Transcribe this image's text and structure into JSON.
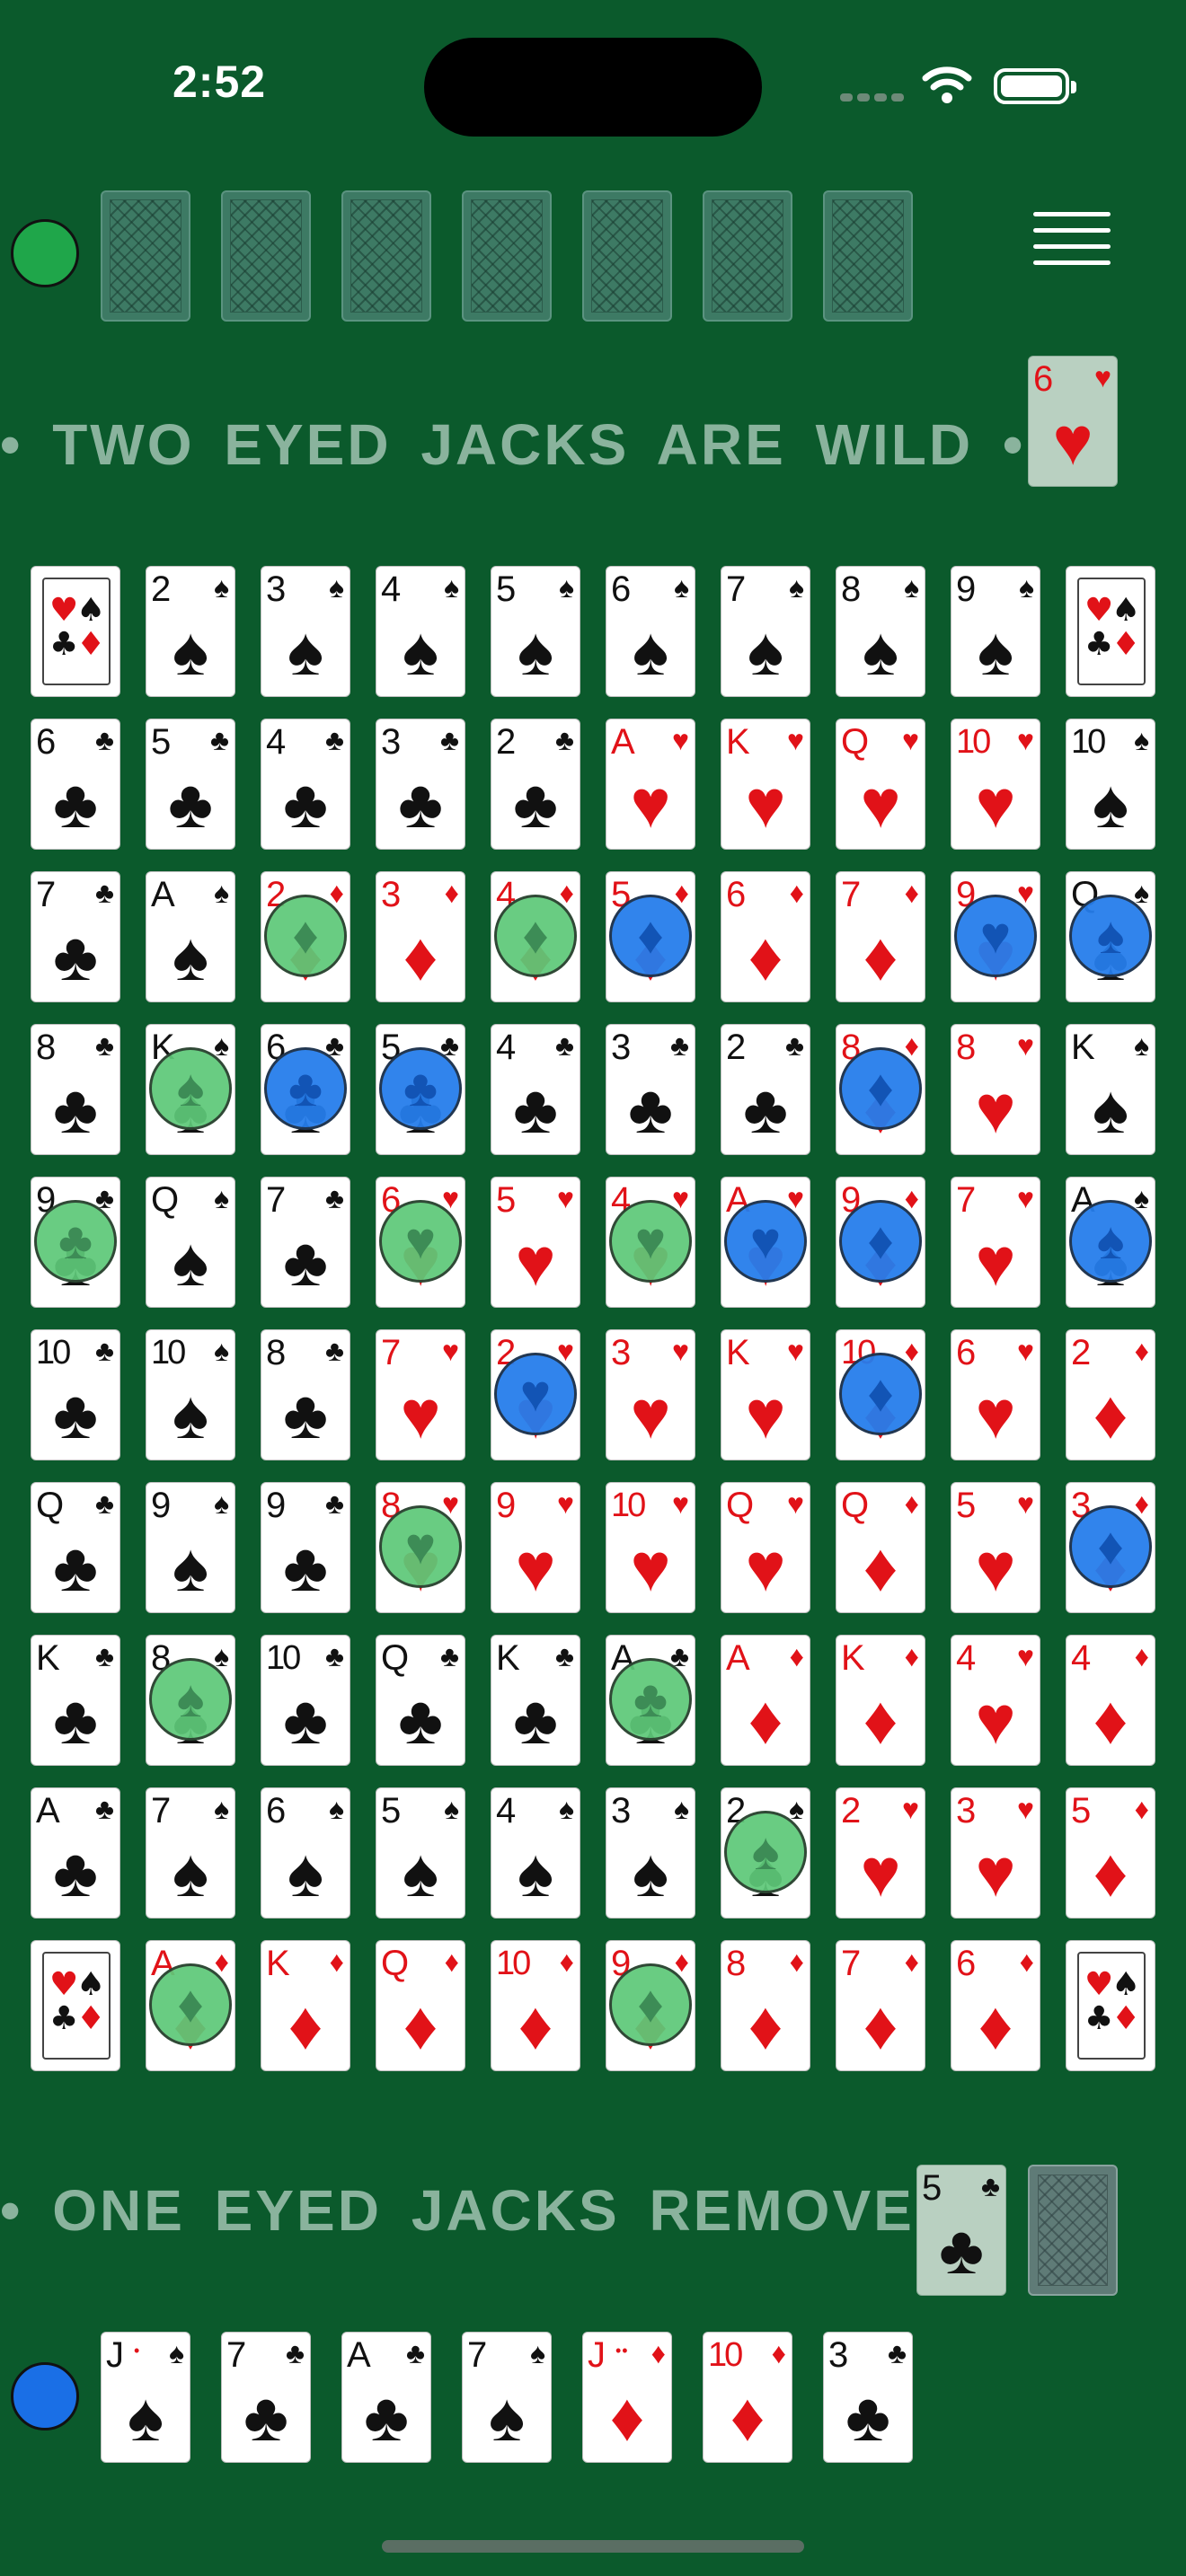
{
  "status_bar": {
    "time": "2:52"
  },
  "colors": {
    "felt": "#0b5a2c",
    "red_suit": "#e11218",
    "black_suit": "#111111",
    "opponent_color": "#1fa64a",
    "player_color": "#1a6fe6",
    "green_chip": "#5ec878",
    "blue_chip": "#2679eb"
  },
  "icons": {
    "menu": "hamburger-menu-icon",
    "wifi": "wifi-icon",
    "battery": "battery-icon",
    "card_back": "card-back-icon",
    "free_corner": "free-corner-suits-icon"
  },
  "top_banner": "• TWO EYED JACKS ARE WILD •",
  "bottom_banner": "• ONE EYED JACKS REMOVE •",
  "opponent": {
    "color": "green",
    "card_count": 7
  },
  "top_discard": {
    "rank": "6",
    "suit": "♥",
    "color": "red"
  },
  "bottom_discard": {
    "rank": "5",
    "suit": "♣",
    "color": "black"
  },
  "player": {
    "color": "blue",
    "hand": [
      {
        "rank": "J",
        "suit": "♠",
        "color": "black",
        "jack_eyes": "•"
      },
      {
        "rank": "7",
        "suit": "♣",
        "color": "black"
      },
      {
        "rank": "A",
        "suit": "♣",
        "color": "black"
      },
      {
        "rank": "7",
        "suit": "♠",
        "color": "black"
      },
      {
        "rank": "J",
        "suit": "♦",
        "color": "red",
        "jack_eyes": "••"
      },
      {
        "rank": "10",
        "suit": "♦",
        "color": "red"
      },
      {
        "rank": "3",
        "suit": "♣",
        "color": "black"
      }
    ]
  },
  "board": [
    [
      "FREE",
      "2♠",
      "3♠",
      "4♠",
      "5♠",
      "6♠",
      "7♠",
      "8♠",
      "9♠",
      "FREE"
    ],
    [
      "6♣",
      "5♣",
      "4♣",
      "3♣",
      "2♣",
      "A♥",
      "K♥",
      "Q♥",
      "10♥",
      "10♠"
    ],
    [
      "7♣",
      "A♠",
      "2♦",
      "3♦",
      "4♦",
      "5♦",
      "6♦",
      "7♦",
      "9♥",
      "Q♠"
    ],
    [
      "8♣",
      "K♠",
      "6♣",
      "5♣",
      "4♣",
      "3♣",
      "2♣",
      "8♦",
      "8♥",
      "K♠"
    ],
    [
      "9♣",
      "Q♠",
      "7♣",
      "6♥",
      "5♥",
      "4♥",
      "A♥",
      "9♦",
      "7♥",
      "A♠"
    ],
    [
      "10♣",
      "10♠",
      "8♣",
      "7♥",
      "2♥",
      "3♥",
      "K♥",
      "10♦",
      "6♥",
      "2♦"
    ],
    [
      "Q♣",
      "9♠",
      "9♣",
      "8♥",
      "9♥",
      "10♥",
      "Q♥",
      "Q♦",
      "5♥",
      "3♦"
    ],
    [
      "K♣",
      "8♠",
      "10♣",
      "Q♣",
      "K♣",
      "A♣",
      "A♦",
      "K♦",
      "4♥",
      "4♦"
    ],
    [
      "A♣",
      "7♠",
      "6♠",
      "5♠",
      "4♠",
      "3♠",
      "2♠",
      "2♥",
      "3♥",
      "5♦"
    ],
    [
      "FREE",
      "A♦",
      "K♦",
      "Q♦",
      "10♦",
      "9♦",
      "8♦",
      "7♦",
      "6♦",
      "FREE"
    ]
  ],
  "chips": [
    {
      "row": 2,
      "col": 2,
      "color": "green"
    },
    {
      "row": 2,
      "col": 4,
      "color": "green"
    },
    {
      "row": 2,
      "col": 5,
      "color": "blue"
    },
    {
      "row": 2,
      "col": 8,
      "color": "blue"
    },
    {
      "row": 2,
      "col": 9,
      "color": "blue"
    },
    {
      "row": 3,
      "col": 1,
      "color": "green"
    },
    {
      "row": 3,
      "col": 2,
      "color": "blue"
    },
    {
      "row": 3,
      "col": 3,
      "color": "blue"
    },
    {
      "row": 3,
      "col": 7,
      "color": "blue"
    },
    {
      "row": 4,
      "col": 0,
      "color": "green"
    },
    {
      "row": 4,
      "col": 3,
      "color": "green"
    },
    {
      "row": 4,
      "col": 5,
      "color": "green"
    },
    {
      "row": 4,
      "col": 6,
      "color": "blue"
    },
    {
      "row": 4,
      "col": 7,
      "color": "blue"
    },
    {
      "row": 4,
      "col": 9,
      "color": "blue"
    },
    {
      "row": 5,
      "col": 4,
      "color": "blue"
    },
    {
      "row": 5,
      "col": 7,
      "color": "blue"
    },
    {
      "row": 6,
      "col": 3,
      "color": "green"
    },
    {
      "row": 6,
      "col": 9,
      "color": "blue"
    },
    {
      "row": 7,
      "col": 1,
      "color": "green"
    },
    {
      "row": 7,
      "col": 5,
      "color": "green"
    },
    {
      "row": 8,
      "col": 6,
      "color": "green"
    },
    {
      "row": 9,
      "col": 1,
      "color": "green"
    },
    {
      "row": 9,
      "col": 5,
      "color": "green"
    }
  ]
}
